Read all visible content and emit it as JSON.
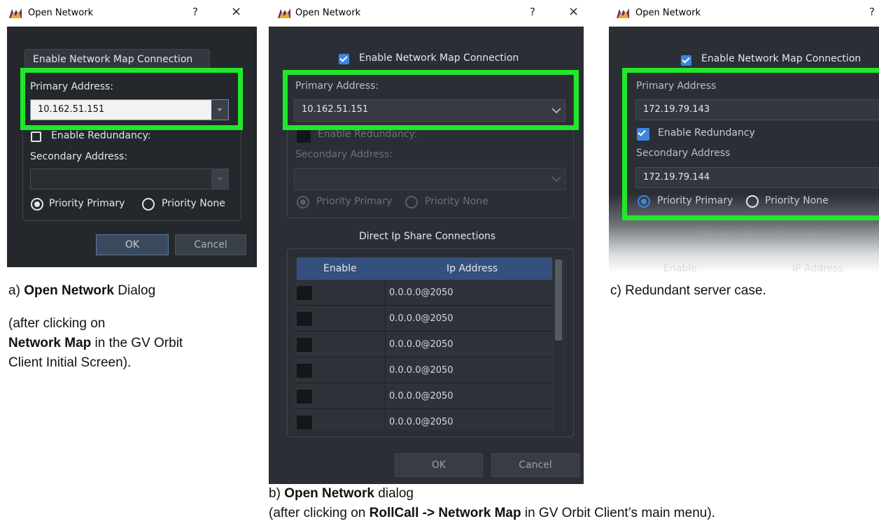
{
  "dialog_title": "Open Network",
  "help_glyph": "?",
  "close_glyph": "×",
  "panel_a": {
    "enable_map_label": "Enable Network Map Connection",
    "primary_label": "Primary Address:",
    "primary_value": "10.162.51.151",
    "enable_redundancy_label": "Enable Redundancy:",
    "secondary_label": "Secondary Address:",
    "secondary_value": "",
    "priority_primary": "Priority Primary",
    "priority_none": "Priority None",
    "ok": "OK",
    "cancel": "Cancel",
    "enable_map_checked": false,
    "enable_redundancy_checked": false
  },
  "panel_b": {
    "enable_map_label": "Enable Network Map Connection",
    "enable_map_checked": true,
    "primary_label": "Primary Address:",
    "primary_value": "10.162.51.151",
    "enable_redundancy_label": "Enable Redundancy:",
    "secondary_label": "Secondary Address:",
    "secondary_value": "",
    "priority_primary": "Priority Primary",
    "priority_none": "Priority None",
    "share_title": "Direct Ip Share Connections",
    "table_headers": [
      "Enable",
      "Ip Address"
    ],
    "table_rows": [
      "0.0.0.0@2050",
      "0.0.0.0@2050",
      "0.0.0.0@2050",
      "0.0.0.0@2050",
      "0.0.0.0@2050",
      "0.0.0.0@2050"
    ],
    "ok": "OK",
    "cancel": "Cancel"
  },
  "panel_c": {
    "enable_map_label": "Enable Network Map Connection",
    "enable_map_checked": true,
    "primary_label": "Primary Address",
    "primary_value": "172.19.79.143",
    "enable_redundancy_label": "Enable Redundancy",
    "enable_redundancy_checked": true,
    "secondary_label": "Secondary Address",
    "secondary_value": "172.19.79.144",
    "priority_primary": "Priority Primary",
    "priority_none": "Priority None",
    "share_title": "Direct Ip Share Connections",
    "table_headers": [
      "Enable",
      "IP Address"
    ]
  },
  "captions": {
    "a_prefix": "a) ",
    "a_bold": "Open Network",
    "a_suffix": " Dialog",
    "a_note_1": "(after clicking on",
    "a_note_2_bold": "Network Map",
    "a_note_2_rest": " in the GV Orbit",
    "a_note_3": "Client Initial Screen).",
    "b_prefix": "b) ",
    "b_bold": "Open Network",
    "b_suffix": " dialog",
    "b_note_prefix": "(after clicking on ",
    "b_note_bold": "RollCall -> Network Map",
    "b_note_suffix": " in GV Orbit Client’s main menu).",
    "c_text": "c) Redundant server case."
  },
  "colors": {
    "highlight": "#20e82a",
    "accent_blue": "#3b86e0",
    "dialog_bg": "#2b2f35",
    "table_header": "#34507e"
  }
}
